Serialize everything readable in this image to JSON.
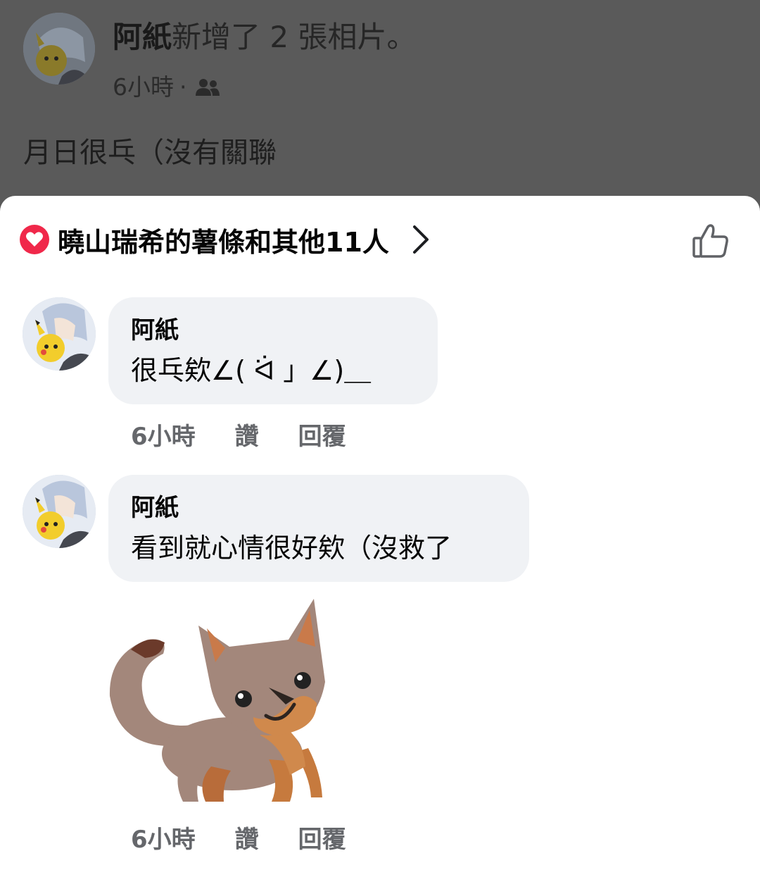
{
  "post": {
    "author": "阿紙",
    "action": "新增了 2 張相片。",
    "time": "6小時",
    "separator": "·",
    "audience_icon": "friends-icon",
    "body": "月日很乓（沒有關聯"
  },
  "reactions": {
    "icon": "heart-reaction-icon",
    "summary": "曉山瑞希的薯條和其他11人",
    "chevron_icon": "chevron-right-icon",
    "like_icon": "thumbs-up-icon"
  },
  "comments": [
    {
      "author": "阿紙",
      "text": "很乓欸∠( ᐛ 」∠)＿",
      "time": "6小時",
      "like": "讚",
      "reply": "回覆"
    },
    {
      "author": "阿紙",
      "text": "看到就心情很好欸（沒救了",
      "sticker": "fox-sticker",
      "time": "6小時",
      "like": "讚",
      "reply": "回覆"
    }
  ],
  "colors": {
    "heart": "#f0284a",
    "bubble": "#f0f2f5",
    "secondary_text": "#65676b",
    "overlay": "#5a5a5a"
  }
}
